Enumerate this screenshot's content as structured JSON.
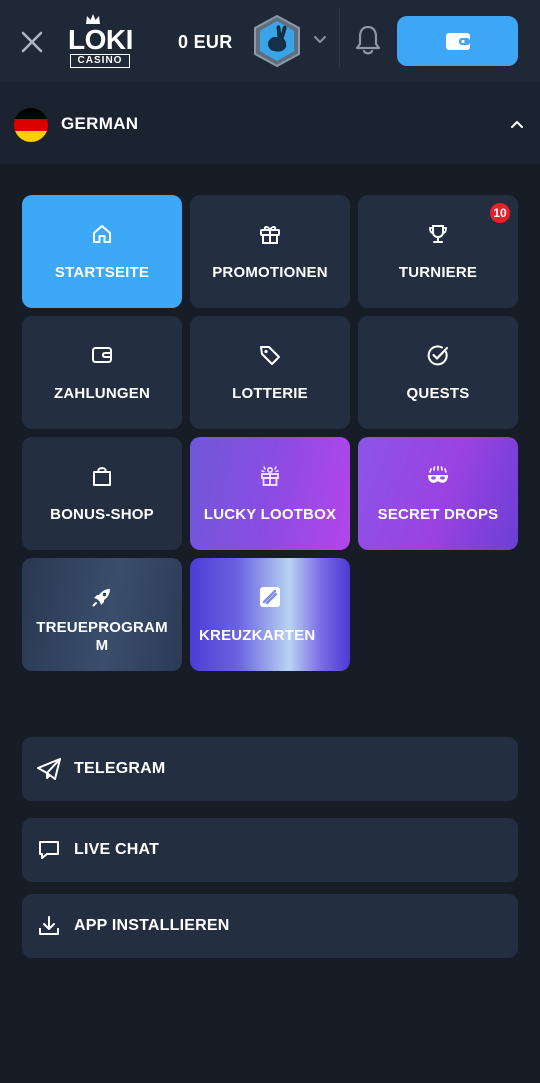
{
  "header": {
    "logo_text": "LOKI",
    "logo_sub": "CASINO",
    "balance": "0 EUR",
    "icons": [
      "close-icon",
      "bell-icon",
      "wallet-icon",
      "chevron-down-icon",
      "rabbit-avatar-icon"
    ]
  },
  "language": {
    "label": "GERMAN",
    "flag": "germany-flag",
    "expanded": true
  },
  "tiles": [
    {
      "label": "STARTSEITE",
      "icon": "home-icon",
      "active": true
    },
    {
      "label": "PROMOTIONEN",
      "icon": "gift-icon"
    },
    {
      "label": "TURNIERE",
      "icon": "trophy-icon",
      "badge": "10"
    },
    {
      "label": "ZAHLUNGEN",
      "icon": "wallet-icon"
    },
    {
      "label": "LOTTERIE",
      "icon": "tag-icon"
    },
    {
      "label": "QUESTS",
      "icon": "check-circle-icon"
    },
    {
      "label": "BONUS-SHOP",
      "icon": "shopping-bag-icon"
    },
    {
      "label": "LUCKY LOOTBOX",
      "icon": "lootbox-icon"
    },
    {
      "label": "SECRET DROPS",
      "icon": "mask-icon"
    },
    {
      "label": "TREUEPROGRAM M",
      "icon": "rocket-icon"
    },
    {
      "label": "KREUZKARTEN",
      "icon": "cards-icon"
    }
  ],
  "links": [
    {
      "label": "TELEGRAM",
      "icon": "telegram-icon"
    },
    {
      "label": "LIVE CHAT",
      "icon": "chat-icon"
    },
    {
      "label": "APP INSTALLIEREN",
      "icon": "download-icon"
    }
  ],
  "colors": {
    "background": "#171d26",
    "header": "#1e2836",
    "tile": "#232f41",
    "accent": "#3da6f5",
    "badge": "#e5222c"
  }
}
